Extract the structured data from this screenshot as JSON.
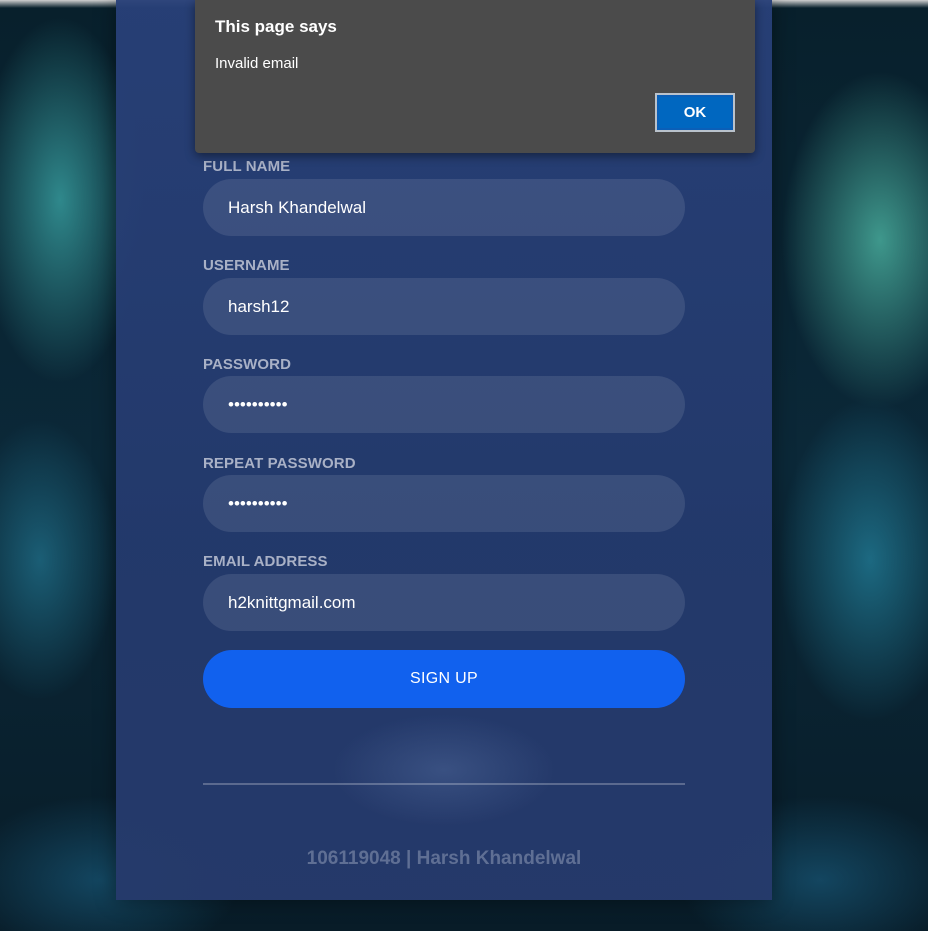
{
  "form": {
    "fields": [
      {
        "label": "FULL NAME",
        "value": "Harsh Khandelwal"
      },
      {
        "label": "USERNAME",
        "value": "harsh12"
      },
      {
        "label": "PASSWORD",
        "value": "••••••••••"
      },
      {
        "label": "REPEAT PASSWORD",
        "value": "••••••••••"
      },
      {
        "label": "EMAIL ADDRESS",
        "value": "h2knittgmail.com"
      }
    ],
    "submit_label": "SIGN UP",
    "footer_text": "106119048 | Harsh Khandelwal"
  },
  "dialog": {
    "title": "This page says",
    "message": "Invalid email",
    "ok_label": "OK"
  },
  "colors": {
    "button": "#1161ee",
    "dialog_bg": "#4b4b4b",
    "dialog_ok": "#0067c0",
    "label": "#a9b1c6"
  }
}
